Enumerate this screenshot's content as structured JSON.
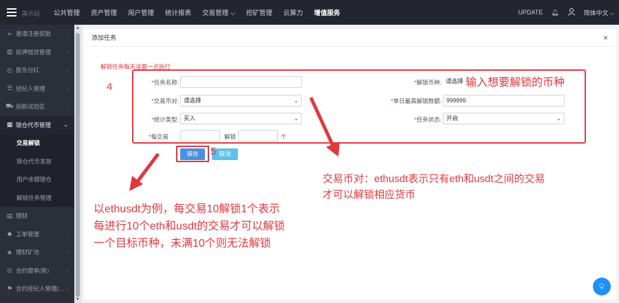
{
  "topbar": {
    "logo_text": "演示站",
    "nav": [
      "公共管理",
      "资产管理",
      "用户管理",
      "统计报表",
      "交易管理",
      "挖矿管理",
      "云算力",
      "增值服务"
    ],
    "nav_dropdown": "交易管理",
    "nav_active": "增值服务",
    "update_label": "UPDATE",
    "lang_label": "简体中文"
  },
  "sidebar": {
    "items": [
      {
        "label": "邀请注册奖励",
        "icon": "send-icon"
      },
      {
        "label": "抵押借贷管理",
        "icon": "chart-icon"
      },
      {
        "label": "股东分红",
        "icon": "clock-icon"
      },
      {
        "label": "经纪人管理",
        "icon": "list-icon"
      },
      {
        "label": "创新试验区",
        "icon": "cart-icon"
      },
      {
        "label": "锁仓代币管理",
        "icon": "table-icon"
      }
    ],
    "sub_items": [
      "交易解锁",
      "锁仓代币发放",
      "用户余额锁仓",
      "解锁任务管理"
    ],
    "sub_active": "交易解锁",
    "items_after": [
      {
        "label": "理财",
        "icon": "doc-icon"
      },
      {
        "label": "工单管理",
        "icon": "diamond-icon"
      },
      {
        "label": "理财矿池",
        "icon": "tag-icon"
      },
      {
        "label": "合约跟单(新)",
        "icon": "copy-icon"
      },
      {
        "label": "合约经纪人管理(...",
        "icon": "broker-icon"
      }
    ]
  },
  "panel": {
    "title": "添加任务",
    "close": "×",
    "hint": "解锁任务每天凌晨一点执行"
  },
  "form": {
    "task_name_label": "任务名称:",
    "unlock_coin_label": "解锁币种:",
    "unlock_coin_value": "请选择",
    "pair_label": "交易币对:",
    "pair_value": "请选择",
    "daily_max_label": "单日最高解锁数额:",
    "daily_max_value": "999999",
    "stat_type_label": "统计类型:",
    "stat_type_value": "买入",
    "status_label": "任务状态:",
    "status_value": "开启",
    "per_trade_label": "每交易",
    "unlock_label": "解锁",
    "unit_label": "个",
    "required_mark": "*"
  },
  "buttons": {
    "save": "保存",
    "cancel": "取消"
  },
  "annotations": {
    "step4": "4",
    "step5": "5",
    "coin_note": "输入想要解锁的币种",
    "pair_note_line1": "交易币对：ethusdt表示只有eth和usdt之间的交易",
    "pair_note_line2": "才可以解锁相应货币",
    "example_line1": "以ethusdt为例，每交易10解锁1个表示",
    "example_line2": "每进行10个eth和usdt的交易才可以解锁",
    "example_line3": "一个目标币种，未满10个则无法解锁"
  },
  "colors": {
    "accent_red": "#e0383e",
    "primary_blue": "#4b8fe0",
    "cancel_blue": "#5ec2e8",
    "topbar_bg": "#23262e",
    "sidebar_bg": "#2b2f3a"
  }
}
